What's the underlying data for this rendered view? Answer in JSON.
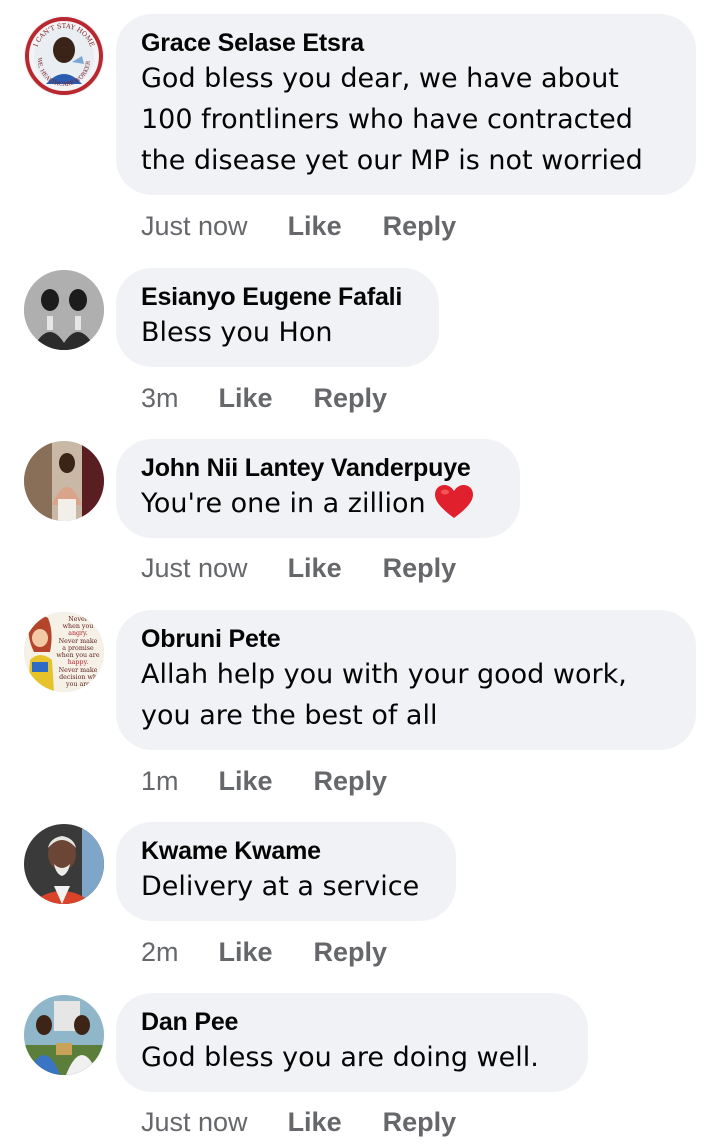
{
  "comments": [
    {
      "author": "Grace Selase Etsra",
      "text": "God bless you dear, we have about\n100 frontliners who have contracted\nthe disease yet our MP is not worried",
      "time": "Just now",
      "avatar_text": [
        "I CAN'T STAY HOME",
        "WE, HEALTHCARE WORKERS"
      ]
    },
    {
      "author": "Esianyo Eugene Fafali",
      "text": "Bless you Hon",
      "time": "3m"
    },
    {
      "author": "John Nii Lantey Vanderpuye",
      "text": "You're one in a zillion",
      "time": "Just now",
      "emoji": "heart-emoji"
    },
    {
      "author": "Obruni Pete",
      "text": "Allah help you with your good work,\nyou are the best of all",
      "time": "1m",
      "avatar_text": [
        "Never",
        "when you",
        "angry.",
        "Never make",
        "a promise",
        "when you are",
        "happy.",
        "Never make",
        "decision wh",
        "you are"
      ]
    },
    {
      "author": "Kwame Kwame",
      "text": "Delivery at a service",
      "time": "2m"
    },
    {
      "author": "Dan Pee",
      "text": "God bless you are doing well.",
      "time": "Just now"
    }
  ],
  "actions": {
    "like": "Like",
    "reply": "Reply"
  },
  "colors": {
    "bubble": "#f0f2f5",
    "primary_text": "#050505",
    "secondary_text": "#65676b",
    "heart": "#e0202c"
  }
}
